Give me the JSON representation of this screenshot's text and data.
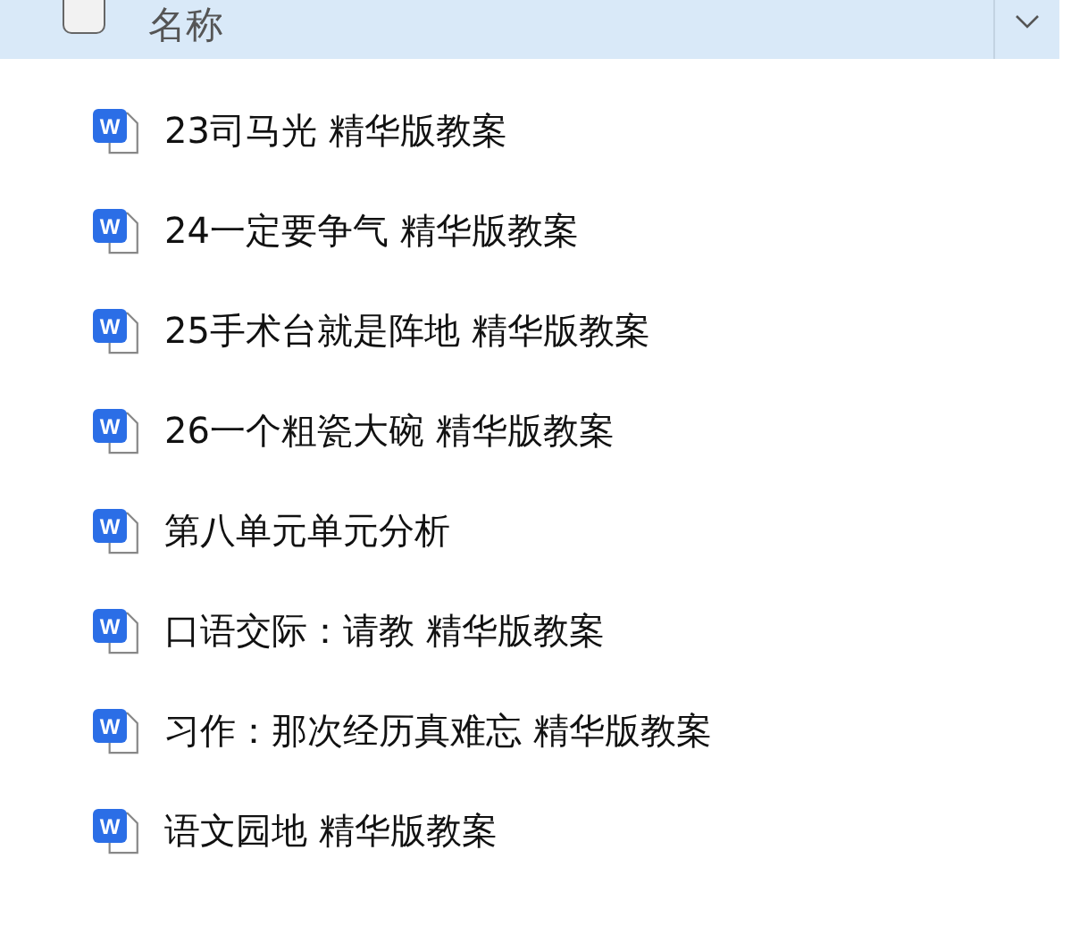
{
  "header": {
    "checked": false,
    "column_label": "名称"
  },
  "files": [
    {
      "icon_label": "W",
      "name": "23司马光 精华版教案"
    },
    {
      "icon_label": "W",
      "name": "24一定要争气 精华版教案"
    },
    {
      "icon_label": "W",
      "name": "25手术台就是阵地 精华版教案"
    },
    {
      "icon_label": "W",
      "name": "26一个粗瓷大碗 精华版教案"
    },
    {
      "icon_label": "W",
      "name": "第八单元单元分析"
    },
    {
      "icon_label": "W",
      "name": "口语交际：请教 精华版教案"
    },
    {
      "icon_label": "W",
      "name": "习作：那次经历真难忘 精华版教案"
    },
    {
      "icon_label": "W",
      "name": "语文园地 精华版教案"
    }
  ]
}
